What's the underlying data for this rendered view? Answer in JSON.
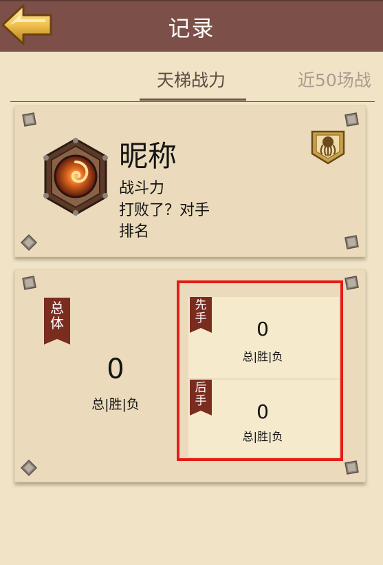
{
  "header": {
    "title": "记录"
  },
  "tabs": [
    {
      "label": "天梯战力"
    },
    {
      "label": "近50场战"
    }
  ],
  "profile": {
    "nickname": "昵称",
    "lines": [
      "战斗力",
      "打败了？对手",
      "排名"
    ]
  },
  "overall": {
    "ribbon": [
      "总",
      "体"
    ],
    "value": "0",
    "wl_label": "总|胜|负"
  },
  "first": {
    "ribbon": [
      "先",
      "手"
    ],
    "value": "0",
    "wl_label": "总|胜|负"
  },
  "second": {
    "ribbon": [
      "后",
      "手"
    ],
    "value": "0",
    "wl_label": "总|胜|负"
  },
  "colors": {
    "header": "#7c4f48",
    "background": "#f1e4c6",
    "card": "#ebdbbc",
    "ribbon": "#7a2c1f",
    "highlight": "#e41c16"
  },
  "icons": [
    "back-arrow-icon",
    "hearthstone-emblem-icon",
    "octopus-rank-badge-icon",
    "corner-stud-icon"
  ]
}
